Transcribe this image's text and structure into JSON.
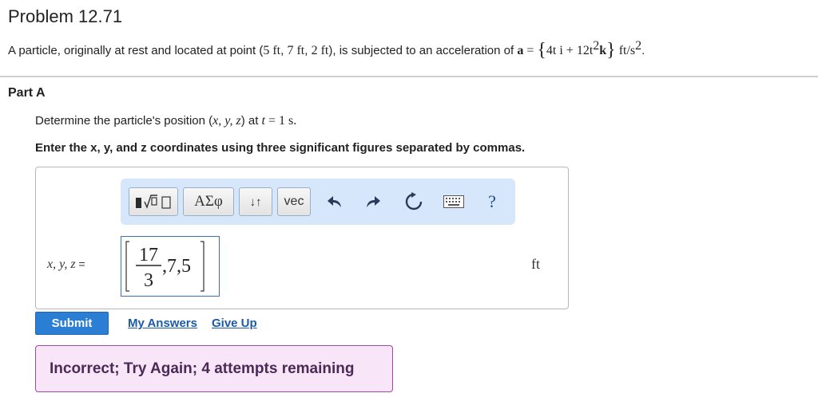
{
  "problem": {
    "title": "Problem 12.71",
    "statement_prefix": "A particle, originally at rest and located at point (",
    "p1": "5 ft",
    "sep1": ", ",
    "p2": "7 ft",
    "sep2": ", ",
    "p3": "2 ft",
    "statement_mid": "), is subjected to an acceleration of ",
    "accel_symbol": "a",
    "accel_eq": " = ",
    "accel_lbrace": "{",
    "accel_term1": "4t i + 12t",
    "accel_exp": "2",
    "accel_k": "k",
    "accel_rbrace": "}",
    "accel_unit": " ft/s",
    "accel_unit_exp": "2",
    "statement_end": "."
  },
  "part": {
    "title": "Part A",
    "question_prefix": "Determine the particle's position (",
    "question_vars": "x, y, z",
    "question_mid": ") at ",
    "question_t": "t",
    "question_end": " = 1 s.",
    "instruction": "Enter the x, y, and z coordinates using three significant figures separated by commas."
  },
  "toolbar": {
    "greek_label": "ΑΣφ",
    "arrows_label": "↓↑",
    "vec_label": "vec",
    "help_label": "?",
    "icons": [
      "templates-icon",
      "undo-icon",
      "redo-icon",
      "reset-icon",
      "keyboard-icon",
      "help-icon"
    ]
  },
  "answer": {
    "label": "x, y, z",
    "equals": " =",
    "fraction_numerator": "17",
    "fraction_denominator": "3",
    "rest": ",7,5",
    "unit": "ft"
  },
  "actions": {
    "submit_label": "Submit",
    "my_answers_label": "My Answers",
    "give_up_label": "Give Up"
  },
  "feedback": {
    "message": "Incorrect; Try Again; 4 attempts remaining"
  },
  "colors": {
    "accent": "#2a7ed3",
    "toolbar_bg": "#d7e7fb",
    "feedback_bg": "#f8e6f8",
    "feedback_border": "#9b4aa6"
  }
}
